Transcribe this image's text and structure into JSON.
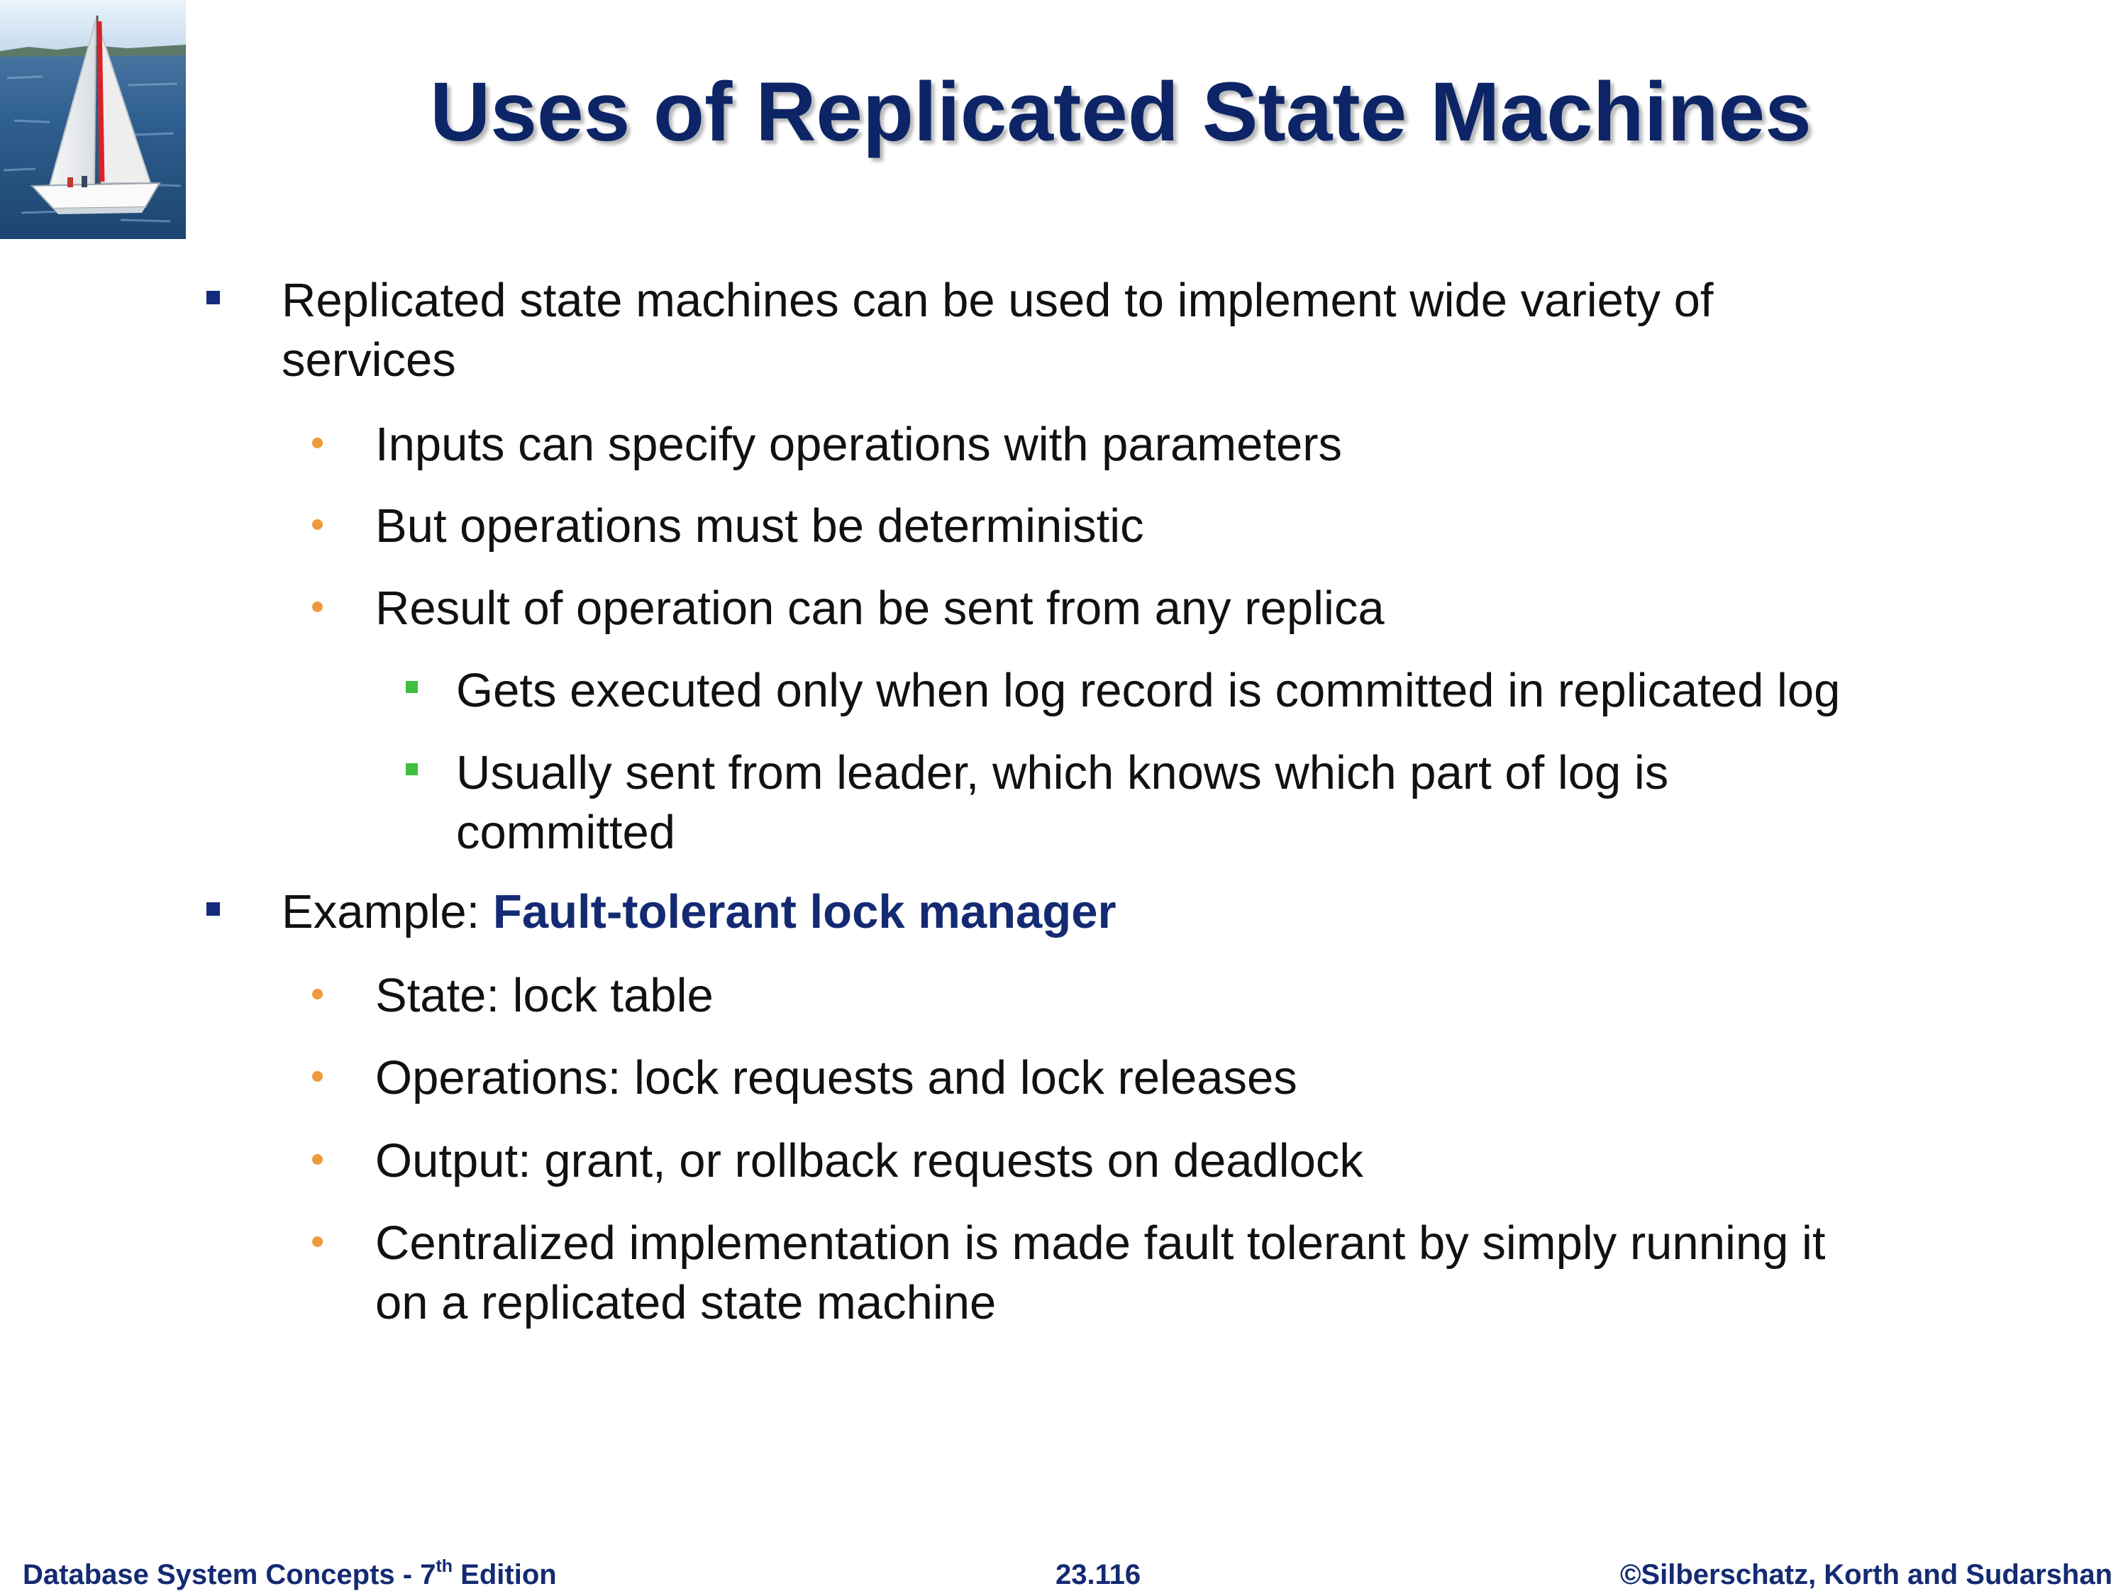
{
  "slide": {
    "title": "Uses of Replicated State Machines",
    "logo": "sailboat-photo",
    "colors": {
      "title": "#0d2566",
      "level1_bullet": "#132c7c",
      "level2_bullet": "#ee9a3a",
      "level3_bullet": "#3fbf3f",
      "emphasis": "#142a73",
      "footer": "#142a73"
    }
  },
  "bullets": [
    {
      "line1": "Replicated state machines can be used to implement wide variety of",
      "line2": "services",
      "sub": [
        {
          "text": "Inputs can specify operations with parameters"
        },
        {
          "text": "But operations must be deterministic"
        },
        {
          "text": "Result of operation can be sent from any replica",
          "sub": [
            {
              "text": "Gets executed only when log record is committed in replicated log"
            },
            {
              "line1": "Usually sent from leader, which knows which part of log is",
              "line2": "committed"
            }
          ]
        }
      ]
    },
    {
      "prefix": "Example: ",
      "emphasis": "Fault-tolerant lock manager",
      "sub": [
        {
          "text": "State: lock table"
        },
        {
          "text": "Operations: lock requests and lock releases"
        },
        {
          "text": "Output: grant, or rollback requests on deadlock"
        },
        {
          "line1": "Centralized implementation is made fault tolerant by simply running it",
          "line2": "on a replicated state machine"
        }
      ]
    }
  ],
  "footer": {
    "left_prefix": "Database System Concepts - 7",
    "left_sup": "th",
    "left_suffix": " Edition",
    "center": "23.116",
    "right": "©Silberschatz, Korth and Sudarshan"
  }
}
